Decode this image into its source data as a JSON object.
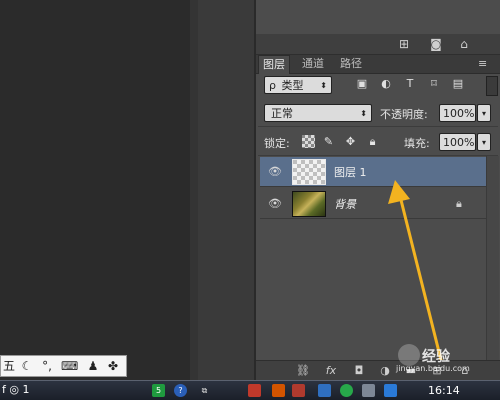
{
  "panel": {
    "tabs": [
      "图层",
      "通道",
      "路径"
    ],
    "filter": {
      "icon": "ρ",
      "label": "类型"
    },
    "blend_mode": "正常",
    "opacity": {
      "label": "不透明度:",
      "value": "100%"
    },
    "lock": {
      "label": "锁定:"
    },
    "fill": {
      "label": "填充:",
      "value": "100%"
    },
    "layers": [
      {
        "name": "图层 1",
        "selected": true
      },
      {
        "name": "背景",
        "italic": true
      }
    ],
    "bottom_icons": [
      "link-icon",
      "fx-icon",
      "mask-icon",
      "adjustment-icon",
      "group-icon",
      "new-layer-icon",
      "trash-icon"
    ]
  },
  "ime_toolbar": {
    "label": "五"
  },
  "taskbar": {
    "left_fragment": "f ◎ 1",
    "time": "16:14"
  },
  "watermark": {
    "brand": "经验",
    "url": "jingyan.baidu.com"
  },
  "colors": {
    "panel_bg": "#4c4c4c",
    "selected_layer": "#5a6f8c",
    "annotation_arrow": "#f3b320"
  }
}
